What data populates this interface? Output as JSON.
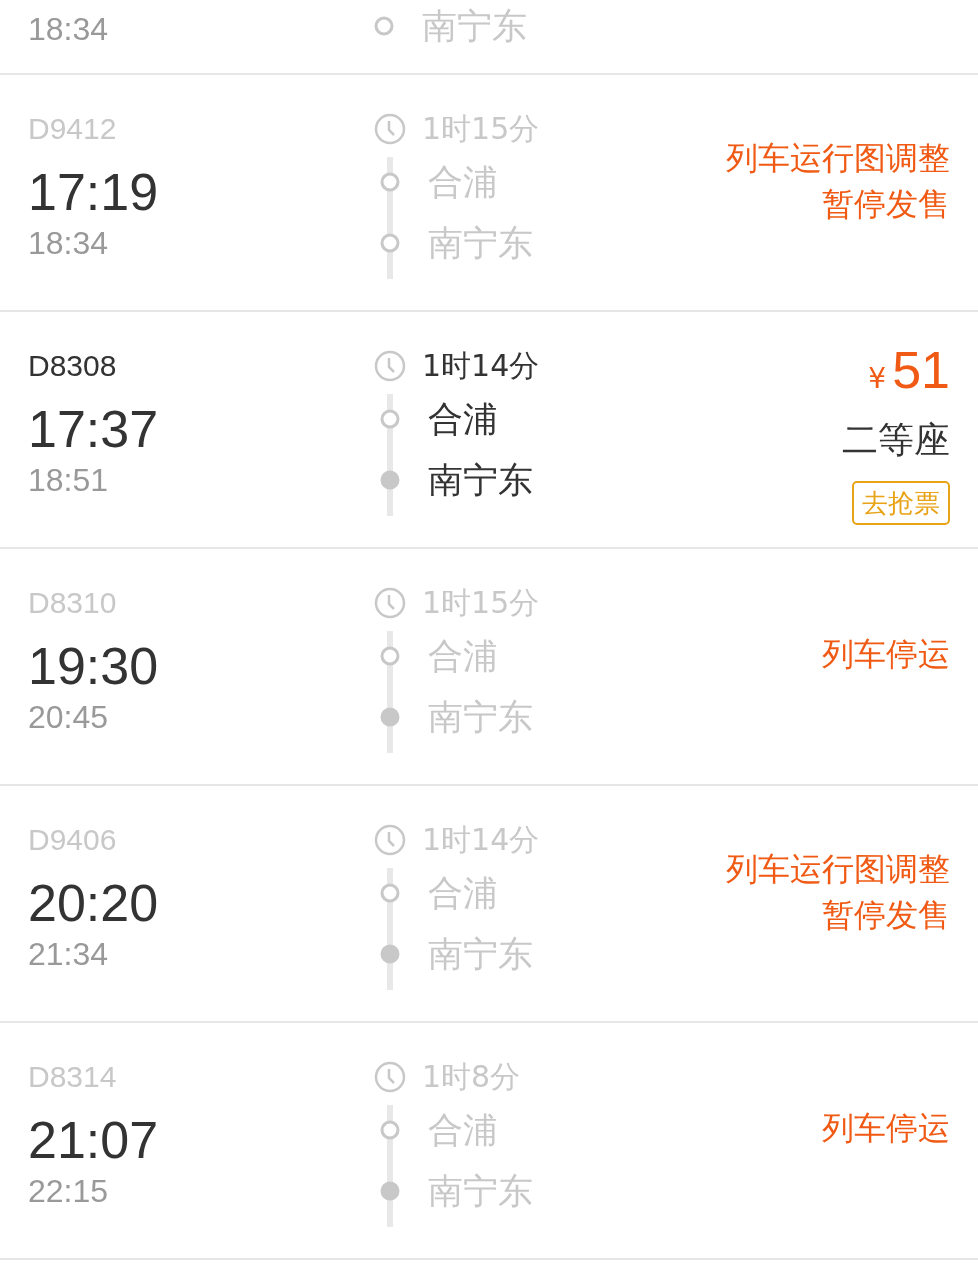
{
  "cut_row": {
    "arrive": "18:34",
    "to": "南宁东",
    "terminal": false
  },
  "trains": [
    {
      "number": "D9412",
      "depart": "17:19",
      "arrive": "18:34",
      "duration": "1时15分",
      "from": "合浦",
      "to": "南宁东",
      "available": false,
      "terminal": false,
      "status": {
        "kind": "notice",
        "lines": [
          "列车运行图调整",
          "暂停发售"
        ]
      }
    },
    {
      "number": "D8308",
      "depart": "17:37",
      "arrive": "18:51",
      "duration": "1时14分",
      "from": "合浦",
      "to": "南宁东",
      "available": true,
      "terminal": true,
      "status": {
        "kind": "price",
        "currency": "¥",
        "price": "51",
        "seat": "二等座",
        "button": "去抢票"
      }
    },
    {
      "number": "D8310",
      "depart": "19:30",
      "arrive": "20:45",
      "duration": "1时15分",
      "from": "合浦",
      "to": "南宁东",
      "available": false,
      "terminal": true,
      "status": {
        "kind": "notice",
        "lines": [
          "列车停运"
        ]
      }
    },
    {
      "number": "D9406",
      "depart": "20:20",
      "arrive": "21:34",
      "duration": "1时14分",
      "from": "合浦",
      "to": "南宁东",
      "available": false,
      "terminal": true,
      "status": {
        "kind": "notice",
        "lines": [
          "列车运行图调整",
          "暂停发售"
        ]
      }
    },
    {
      "number": "D8314",
      "depart": "21:07",
      "arrive": "22:15",
      "duration": "1时8分",
      "from": "合浦",
      "to": "南宁东",
      "available": false,
      "terminal": true,
      "status": {
        "kind": "notice",
        "lines": [
          "列车停运"
        ]
      }
    }
  ]
}
